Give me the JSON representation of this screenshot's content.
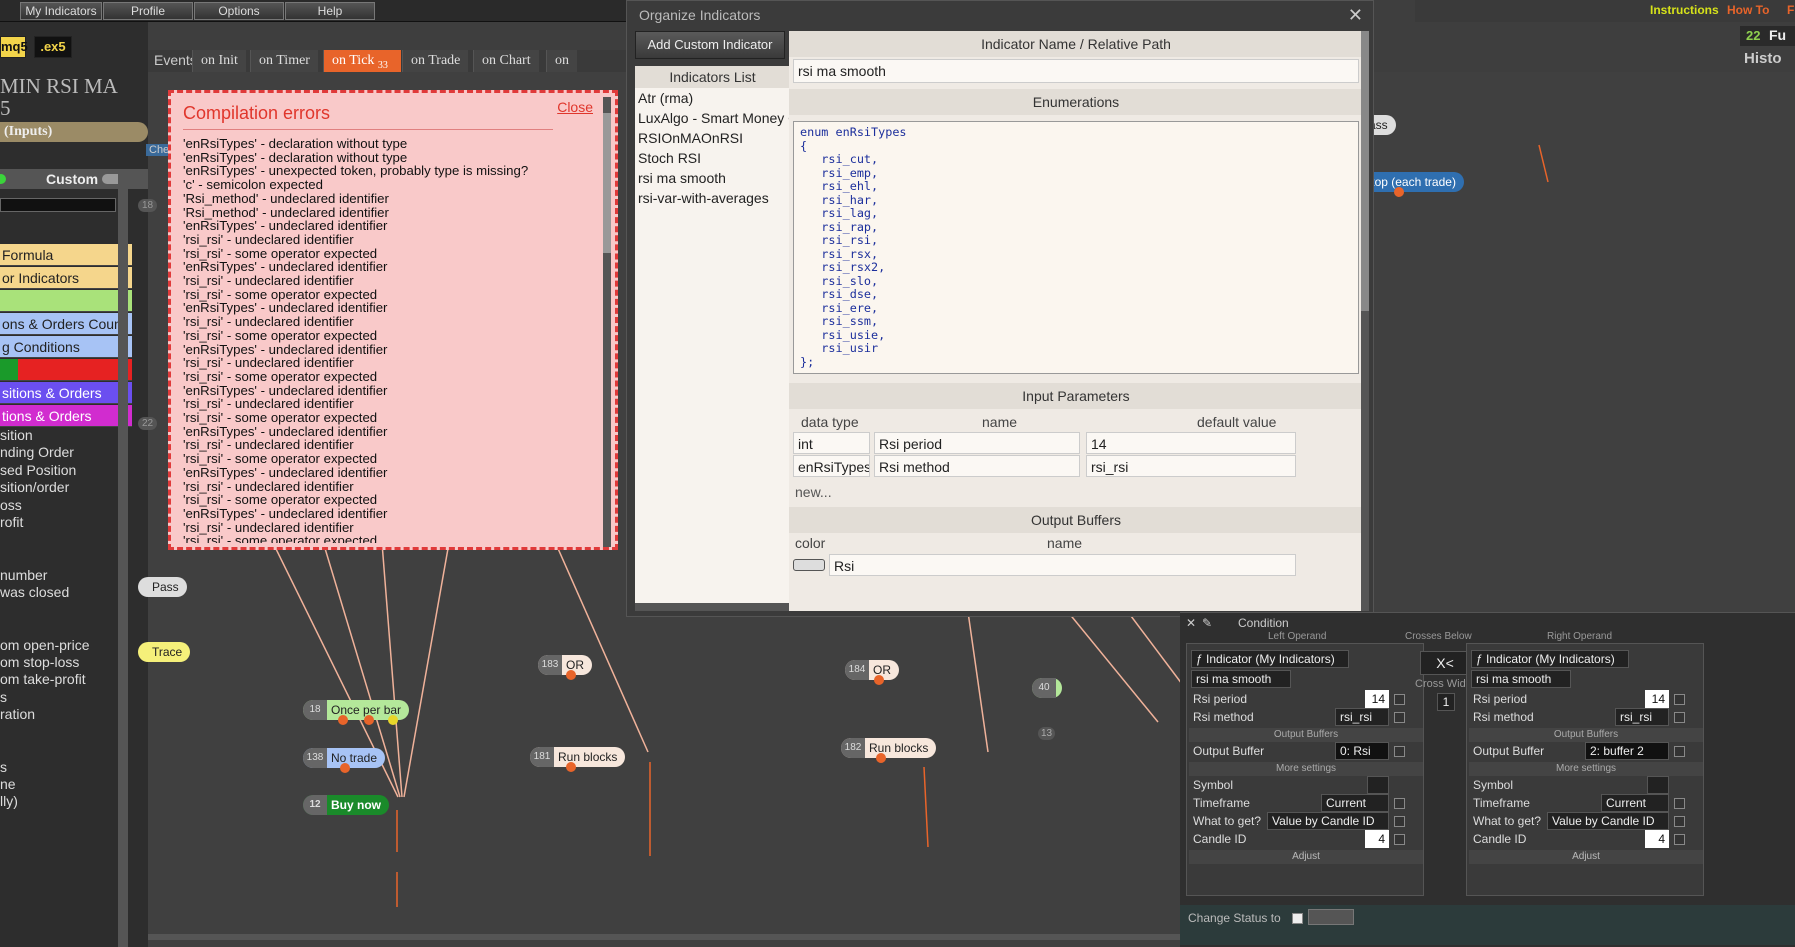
{
  "menu": {
    "items": [
      "My Indicators",
      "Profile",
      "Options",
      "Help"
    ]
  },
  "topright": {
    "instructions": "Instructions",
    "howto": "How To",
    "f": "F",
    "count": "22",
    "fu": "Fu",
    "histo": "Histo"
  },
  "left": {
    "ext_mq5": "mq5",
    "ext_ex5": ".ex5",
    "project_title": "MIN RSI MA",
    "project_sub": "5",
    "inputs_btn": "(Inputs)",
    "custom_label": "Custom",
    "check_frag": "Checl",
    "categories": [
      "Formula",
      "or Indicators",
      "",
      "ons & Orders Count",
      "g Conditions",
      "",
      "sitions & Orders",
      "tions & Orders"
    ],
    "blocks": [
      "sition",
      "nding Order",
      "sed Position",
      "sition/order",
      "oss",
      "rofit",
      "",
      "",
      "number",
      "was closed",
      "",
      "om open-price",
      "om stop-loss",
      "om take-profit",
      "s",
      "ration",
      "",
      "",
      "s",
      "ne",
      "lly)"
    ],
    "canvas_ids": [
      "18",
      "22"
    ]
  },
  "events": {
    "label": "Events",
    "tabs": [
      "on Init",
      "on Timer",
      "on Tick",
      "on Trade",
      "on Chart",
      "on"
    ],
    "tick_badge": "33"
  },
  "nodes": {
    "pass_top": {
      "id": "136",
      "label": "Pass"
    },
    "trailing": {
      "id": "137",
      "label": "Trailing stop (each trade)"
    },
    "pass_left": {
      "label": "Pass"
    },
    "trace_left": {
      "label": "Trace"
    },
    "once": {
      "id": "18",
      "label": "Once per bar"
    },
    "notrade": {
      "id": "138",
      "label": "No trade"
    },
    "buy": {
      "id": "12",
      "label": "Buy now"
    },
    "or1": {
      "id": "183",
      "label": "OR"
    },
    "run1": {
      "id": "181",
      "label": "Run blocks"
    },
    "or2": {
      "id": "184",
      "label": "OR"
    },
    "run2": {
      "id": "182",
      "label": "Run blocks"
    },
    "n40": {
      "id": "40"
    },
    "n13": {
      "id": "13"
    }
  },
  "errors": {
    "title": "Compilation errors",
    "close": "Close",
    "lines": [
      "'enRsiTypes' - declaration without type",
      "'enRsiTypes' - declaration without type",
      "'enRsiTypes' - unexpected token, probably type is missing?",
      "'c' - semicolon expected",
      "'Rsi_method' - undeclared identifier",
      "'Rsi_method' - undeclared identifier",
      "'enRsiTypes' - undeclared identifier",
      "'rsi_rsi' - undeclared identifier",
      "'rsi_rsi' - some operator expected",
      "'enRsiTypes' - undeclared identifier",
      "'rsi_rsi' - undeclared identifier",
      "'rsi_rsi' - some operator expected",
      "'enRsiTypes' - undeclared identifier",
      "'rsi_rsi' - undeclared identifier",
      "'rsi_rsi' - some operator expected",
      "'enRsiTypes' - undeclared identifier",
      "'rsi_rsi' - undeclared identifier",
      "'rsi_rsi' - some operator expected",
      "'enRsiTypes' - undeclared identifier",
      "'rsi_rsi' - undeclared identifier",
      "'rsi_rsi' - some operator expected",
      "'enRsiTypes' - undeclared identifier",
      "'rsi_rsi' - undeclared identifier",
      "'rsi_rsi' - some operator expected",
      "'enRsiTypes' - undeclared identifier",
      "'rsi_rsi' - undeclared identifier",
      "'rsi_rsi' - some operator expected",
      "'enRsiTypes' - undeclared identifier",
      "'rsi_rsi' - undeclared identifier",
      "'rsi_rsi' - some operator expected",
      "'enRsiTypes' - undeclared identifier"
    ]
  },
  "organize": {
    "title": "Organize Indicators",
    "add_button": "Add Custom Indicator",
    "list_header": "Indicators List",
    "list": [
      "Atr (rma)",
      "LuxAlgo - Smart Money C",
      "RSIOnMAOnRSI",
      "Stoch RSI",
      "rsi ma smooth",
      "rsi-var-with-averages"
    ],
    "name_header": "Indicator Name / Relative Path",
    "name_value": "rsi ma smooth",
    "enum_header": "Enumerations",
    "enum_code": "enum enRsiTypes\n{\n   rsi_cut,\n   rsi_emp,\n   rsi_ehl,\n   rsi_har,\n   rsi_lag,\n   rsi_rap,\n   rsi_rsi,\n   rsi_rsx,\n   rsi_rsx2,\n   rsi_slo,\n   rsi_dse,\n   rsi_ere,\n   rsi_ssm,\n   rsi_usie,\n   rsi_usir\n};",
    "input_header": "Input Parameters",
    "col_type": "data type",
    "col_name": "name",
    "col_default": "default value",
    "params": [
      {
        "type": "int",
        "name": "Rsi period",
        "default": "14"
      },
      {
        "type": "enRsiTypes",
        "name": "Rsi method",
        "default": "rsi_rsi"
      }
    ],
    "new_link": "new...",
    "output_header": "Output Buffers",
    "col_color": "color",
    "col_bname": "name",
    "buffer_name": "Rsi"
  },
  "condition": {
    "title": "Condition",
    "left_operand": "Left Operand",
    "right_operand": "Right Operand",
    "crosses_below": "Crosses Below",
    "cross_width_label": "Cross Width",
    "cross_width": "1",
    "operator": "X<",
    "indicator_type": "Indicator (My Indicators)",
    "indicator_name": "rsi ma smooth",
    "rsi_period_label": "Rsi period",
    "rsi_period": "14",
    "rsi_method_label": "Rsi method",
    "rsi_method": "rsi_rsi",
    "output_buffers_sep": "Output Buffers",
    "output_buffer_label": "Output Buffer",
    "left_buffer": "0: Rsi",
    "right_buffer": "2: buffer 2",
    "more_settings": "More settings",
    "symbol_label": "Symbol",
    "timeframe_label": "Timeframe",
    "timeframe": "Current",
    "what_label": "What to get?",
    "what": "Value by Candle ID",
    "candle_label": "Candle ID",
    "candle": "4",
    "adjust": "Adjust",
    "change_status": "Change Status to"
  },
  "colors": {
    "accent_orange": "#e8642a",
    "error_red": "#e0362c",
    "node_green": "#9fe27a",
    "node_blue": "#2f6fb0"
  }
}
